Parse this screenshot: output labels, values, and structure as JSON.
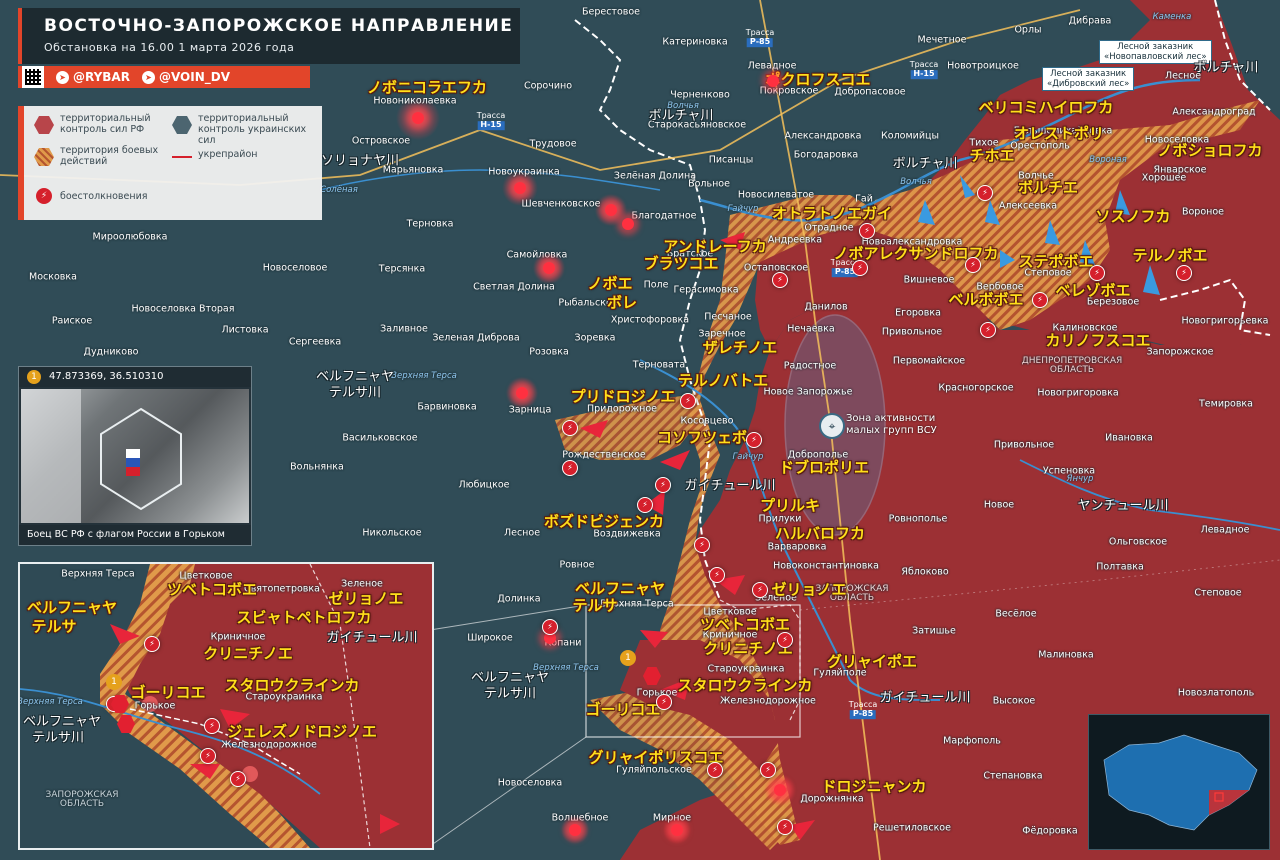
{
  "header": {
    "title": "ВОСТОЧНО-ЗАПОРОЖСКОЕ НАПРАВЛЕНИЕ",
    "subtitle": "Обстановка на 16.00 1 марта 2026 года"
  },
  "social": {
    "rybar": "@RYBAR",
    "voin": "@VOIN_DV"
  },
  "legend": {
    "ru_control": "территориальный контроль сил РФ",
    "ua_control": "территориальный контроль украинских сил",
    "combat": "территория боевых действий",
    "fortified": "укрепрайон",
    "clashes": "боестолкновения"
  },
  "colors": {
    "ru": "#9c3034",
    "ua": "#2e4a55",
    "combat": "#e8a24a",
    "accent": "#e2452a",
    "river": "#3a8fd0"
  },
  "photo": {
    "number": "1",
    "coords": "47.873369, 36.510310",
    "caption": "Боец ВС РФ с флагом России в Горьком"
  },
  "zone": {
    "text1": "Зона активности",
    "text2": "малых групп ВСУ"
  },
  "reserves": [
    {
      "name": "Лесной заказник «Новопавловский лес»",
      "l1": "Лесной заказник",
      "l2": "«Новопавловский лес»"
    },
    {
      "name": "Лесной заказник «Дибровский лес»",
      "l1": "Лесной заказник",
      "l2": "«Дибровский лес»"
    }
  ],
  "highways": [
    {
      "label": "Трасса",
      "code": "Р-85"
    },
    {
      "label": "Трасса",
      "code": "Н-15"
    },
    {
      "label": "Трасса",
      "code": "Н-15"
    },
    {
      "label": "Трасса",
      "code": "Р-85"
    },
    {
      "label": "Трасса",
      "code": "Р-85"
    },
    {
      "label": "Трасса",
      "code": "Р-85"
    }
  ],
  "rivers": [
    "Волчья",
    "Солёная",
    "Волчья",
    "Вороная",
    "Гайчур",
    "Янчур",
    "Гайчур",
    "Янчур",
    "Верхняя Терса",
    "Верхняя Терса",
    "Каменка"
  ],
  "regions": [
    "ДНЕПРОПЕТРОВСКАЯ ОБЛАСТЬ",
    "ЗАПОРОЖСКАЯ ОБЛАСТЬ",
    "ЗАПОРОЖСКАЯ ОБЛАСТЬ"
  ],
  "towns": [
    "Берестовое",
    "Катериновка",
    "Трасса",
    "Левадное",
    "Мечетное",
    "Орлы",
    "Дибрава",
    "Каменка",
    "Новониколаевка",
    "Сорочино",
    "Черненково",
    "Покровское",
    "Добропасовое",
    "Трасса",
    "Новотроицкое",
    "Лесное",
    "Островское",
    "Трудовое",
    "Старокасьяновское",
    "Александровка",
    "Коломийцы",
    "Тихое",
    "Большемихайловка",
    "Александроград",
    "Марьяновка",
    "Новоукраинка",
    "Писанцы",
    "Богодаровка",
    "Орестополь",
    "Новоселовка",
    "Январское",
    "Зелёная Долина",
    "Вольное",
    "Новосилеватое",
    "Гай",
    "Волчье",
    "Хорошее",
    "Шевченковское",
    "Алексеевка",
    "Мироолюбовка",
    "Терновка",
    "Благодатное",
    "Андреевка",
    "Новоалександровка",
    "Отрадное",
    "Вороное",
    "Московка",
    "Новоселовое",
    "Терсянка",
    "Самойловка",
    "Братское",
    "Остаповское",
    "Вишневое",
    "Степовое",
    "Раиское",
    "Светлая Долина",
    "Поле",
    "Герасимовка",
    "Данилов",
    "Вербовое",
    "Березовое",
    "Новогригорьевка",
    "Новоселовка Вторая",
    "Листовка",
    "Заливное",
    "Рыбальское",
    "Христофоровка",
    "Новое Поле",
    "Егоровка",
    "Калиновское",
    "Дудниково",
    "Сергеевка",
    "Зеленая Диброва",
    "Розовка",
    "Зоревка",
    "Песчаное",
    "Нечаевка",
    "Привольное",
    "Первомайское",
    "Запорожское",
    "Заречное",
    "Терновата",
    "Радостное",
    "Красногорское",
    "Новое Запорожье",
    "Темировка",
    "Бaрвиновка",
    "Зарница",
    "Придорожное",
    "Косовцево",
    "Новогригоровка",
    "Васильковское",
    "Рождественское",
    "Доброполье",
    "Привольное",
    "Ивановка",
    "Вольнянка",
    "Любицкое",
    "Гайчурь",
    "Новое",
    "Успеновка",
    "Никольское",
    "Лесное",
    "Воздвижевка",
    "Прилуки",
    "Ровнополье",
    "Варваровка",
    "Левадное",
    "Ольговское",
    "Ровное",
    "Новоконстантиновка",
    "Яблоково",
    "Полтавка",
    "Долинка",
    "Верхняя Терса",
    "Зеленое",
    "Весёлое",
    "Степовое",
    "Широкое",
    "Копани",
    "Цветковое",
    "Криничное",
    "Затишье",
    "Малиновка",
    "Староукраинка",
    "Гуляйполе",
    "Новозлатополь",
    "Горькое",
    "Железнодорожное",
    "Высокое",
    "Марфополь",
    "Новоселовка",
    "Гуляйпольское",
    "Дорожнянка",
    "Степановка",
    "Волшебное",
    "Мирное",
    "Решетиловское",
    "Фёдоровка"
  ],
  "jp_labels": [
    "ノボニコラエフカ",
    "ポクロフスコエ",
    "ソリョナヤ川",
    "ボルチャ川",
    "ベリコミハイロフカ",
    "オレストポリ",
    "ボルチャ川",
    "ボルチャ川",
    "チホエ",
    "ボルチエ",
    "ノボショロフカ",
    "オトラトノエガイ",
    "ノボアレクサンドロフカ",
    "ソスノフカ",
    "アンドレーフカ",
    "ブラツコエ",
    "ステポボエ",
    "テルノボエ",
    "ノボエ",
    "ボレ",
    "ベルボボエ",
    "ベレゾボエ",
    "カリノフスコエ",
    "ザレチノエ",
    "テルノバトエ",
    "プリドロジノエ",
    "コソフツェボ",
    "ドブロポリエ",
    "ガイチュール川",
    "プリルキ",
    "ボズドビジェンカ",
    "ハルバロフカ",
    "ベルフニャヤ",
    "テルサ川",
    "ベルフニャヤ",
    "テルサ",
    "ゼリョノエ",
    "ツベトコボエ",
    "クリニチノエ",
    "グリャイポエ",
    "スタロウクラインカ",
    "ゴーリコエ",
    "ガイチュール川",
    "グリャイポリスコエ",
    "ドロジニャンカ",
    "ベルフニャヤ",
    "テルサ川",
    "ヤンチュール川"
  ],
  "inset": {
    "towns": [
      "Верхняя Терса",
      "Цветковое",
      "Святопетровка",
      "Зеленое",
      "Криничное",
      "Горькое",
      "Староукраинка",
      "Железнодорожное",
      "Верхняя Терса",
      "ЗАПОРОЖСКАЯ ОБЛАСТЬ"
    ],
    "jp": [
      "ベルフニャヤ",
      "テルサ",
      "ツベトコボエ",
      "ゼリョノエ",
      "スビャトペトロフカ",
      "クリニチノエ",
      "ガイチュール川",
      "ゴーリコエ",
      "スタロウクラインカ",
      "ベルフニャヤ",
      "テルサ川",
      "ジェレズノドロジノエ"
    ],
    "number": "1"
  },
  "minimap": {
    "label": "mini-map-ukraine"
  }
}
